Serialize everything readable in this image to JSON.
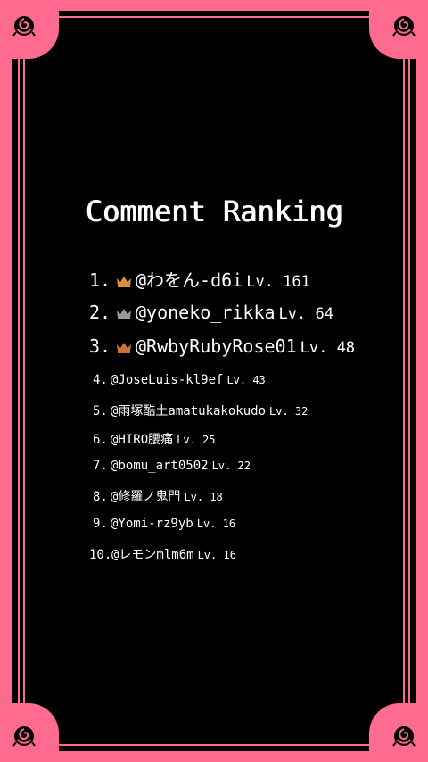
{
  "title": "Comment Ranking",
  "colors": {
    "frame": "#ff6b8f",
    "background": "#000000",
    "text": "#ffffff",
    "gold": "#d4943c",
    "silver": "#9a9a9a",
    "bronze": "#c8743c"
  },
  "ranking": [
    {
      "rank": "1.",
      "name": "@わをん-d6i",
      "level": "Lv. 161",
      "crown": "gold-crown-icon"
    },
    {
      "rank": "2.",
      "name": "@yoneko_rikka",
      "level": "Lv. 64",
      "crown": "silver-crown-icon"
    },
    {
      "rank": "3.",
      "name": "@RwbyRubyRose01",
      "level": "Lv. 48",
      "crown": "bronze-crown-icon"
    },
    {
      "rank": "4.",
      "name": "@JoseLuis-kl9ef",
      "level": "Lv. 43"
    },
    {
      "rank": "5.",
      "name": "@雨塚酷土amatukakokudo",
      "level": "Lv. 32"
    },
    {
      "rank": "6.",
      "name": "@HIRO腰痛",
      "level": "Lv. 25"
    },
    {
      "rank": "7.",
      "name": "@bomu_art0502",
      "level": "Lv. 22"
    },
    {
      "rank": "8.",
      "name": "@修羅ノ鬼門",
      "level": "Lv. 18"
    },
    {
      "rank": "9.",
      "name": "@Yomi-rz9yb",
      "level": "Lv. 16"
    },
    {
      "rank": "10.",
      "name": "@レモンmlm6m",
      "level": "Lv. 16"
    }
  ]
}
